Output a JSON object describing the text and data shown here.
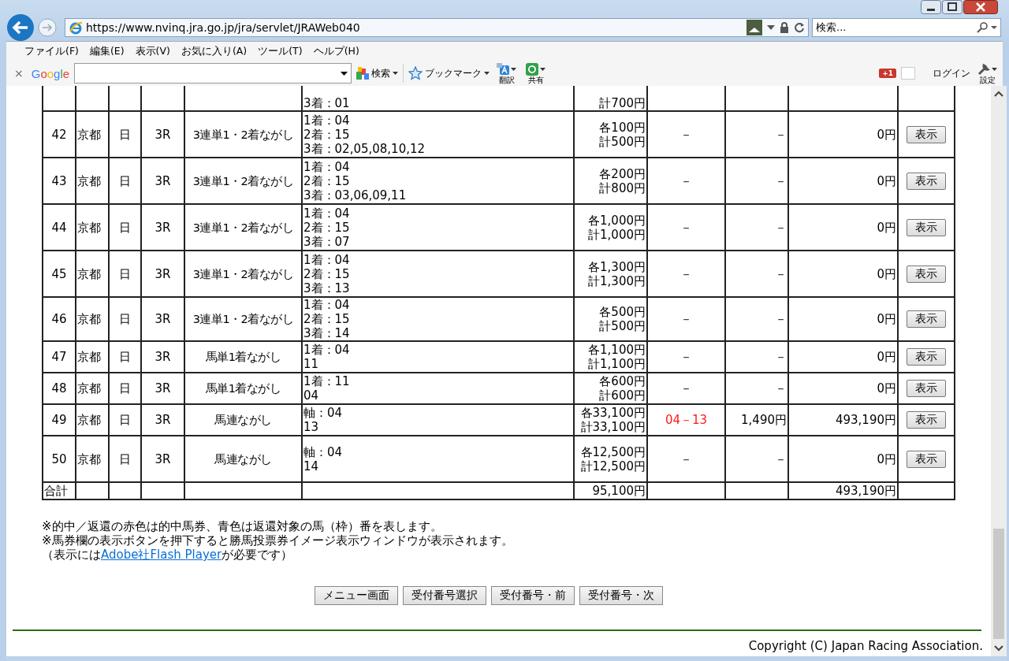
{
  "browser": {
    "url": "https://www.nvinq.jra.go.jp/jra/servlet/JRAWeb040",
    "search_placeholder": "検索...",
    "menu": [
      "ファイル(F)",
      "編集(E)",
      "表示(V)",
      "お気に入り(A)",
      "ツール(T)",
      "ヘルプ(H)"
    ],
    "toolbar": {
      "close": "×",
      "logo": "Google",
      "search": "検索",
      "bookmark": "ブックマーク",
      "translate": "翻訳",
      "share": "共有",
      "plus_one": "+1",
      "login": "ログイン",
      "settings": "設定"
    }
  },
  "table": {
    "cut_off_row": {
      "bets": [
        "3着：01"
      ],
      "amount": [
        "計700円"
      ]
    },
    "rows": [
      {
        "no": "42",
        "place": "京都",
        "day": "日",
        "race": "3R",
        "type": "3連単1・2着ながし",
        "bets": [
          "1着：04",
          "2着：15",
          "3着：02,05,08,10,12"
        ],
        "amount": [
          "各100円",
          "計500円"
        ],
        "hit": "－",
        "hit_win": false,
        "refund": "－",
        "payout": "0円",
        "button": "表示"
      },
      {
        "no": "43",
        "place": "京都",
        "day": "日",
        "race": "3R",
        "type": "3連単1・2着ながし",
        "bets": [
          "1着：04",
          "2着：15",
          "3着：03,06,09,11"
        ],
        "amount": [
          "各200円",
          "計800円"
        ],
        "hit": "－",
        "hit_win": false,
        "refund": "－",
        "payout": "0円",
        "button": "表示"
      },
      {
        "no": "44",
        "place": "京都",
        "day": "日",
        "race": "3R",
        "type": "3連単1・2着ながし",
        "bets": [
          "1着：04",
          "2着：15",
          "3着：07"
        ],
        "amount": [
          "各1,000円",
          "計1,000円"
        ],
        "hit": "－",
        "hit_win": false,
        "refund": "－",
        "payout": "0円",
        "button": "表示"
      },
      {
        "no": "45",
        "place": "京都",
        "day": "日",
        "race": "3R",
        "type": "3連単1・2着ながし",
        "bets": [
          "1着：04",
          "2着：15",
          "3着：13"
        ],
        "amount": [
          "各1,300円",
          "計1,300円"
        ],
        "hit": "－",
        "hit_win": false,
        "refund": "－",
        "payout": "0円",
        "button": "表示"
      },
      {
        "no": "46",
        "place": "京都",
        "day": "日",
        "race": "3R",
        "type": "3連単1・2着ながし",
        "bets": [
          "1着：04",
          "2着：15",
          "3着：14"
        ],
        "amount": [
          "各500円",
          "計500円"
        ],
        "hit": "－",
        "hit_win": false,
        "refund": "－",
        "payout": "0円",
        "button": "表示"
      },
      {
        "no": "47",
        "place": "京都",
        "day": "日",
        "race": "3R",
        "type": "馬単1着ながし",
        "bets": [
          "1着：04",
          "11"
        ],
        "amount": [
          "各1,100円",
          "計1,100円"
        ],
        "hit": "－",
        "hit_win": false,
        "refund": "－",
        "payout": "0円",
        "button": "表示"
      },
      {
        "no": "48",
        "place": "京都",
        "day": "日",
        "race": "3R",
        "type": "馬単1着ながし",
        "bets": [
          "1着：11",
          "04"
        ],
        "amount": [
          "各600円",
          "計600円"
        ],
        "hit": "－",
        "hit_win": false,
        "refund": "－",
        "payout": "0円",
        "button": "表示"
      },
      {
        "no": "49",
        "place": "京都",
        "day": "日",
        "race": "3R",
        "type": "馬連ながし",
        "bets": [
          "軸：04",
          "13"
        ],
        "amount": [
          "各33,100円",
          "計33,100円"
        ],
        "hit": "04－13",
        "hit_win": true,
        "refund": "1,490円",
        "payout": "493,190円",
        "button": "表示"
      },
      {
        "no": "50",
        "place": "京都",
        "day": "日",
        "race": "3R",
        "type": "馬連ながし",
        "bets": [
          "軸：04",
          "14"
        ],
        "amount": [
          "各12,500円",
          "計12,500円"
        ],
        "hit": "－",
        "hit_win": false,
        "refund": "－",
        "payout": "0円",
        "button": "表示"
      }
    ],
    "total": {
      "label": "合計",
      "amount": "95,100円",
      "payout": "493,190円"
    }
  },
  "notes": [
    {
      "text": "※的中／返還の赤色は的中馬券、青色は返還対象の馬（枠）番を表します。"
    },
    {
      "text": "※馬券欄の表示ボタンを押下すると勝馬投票券イメージ表示ウィンドウが表示されます。"
    },
    {
      "text": "（表示には",
      "link": "Adobe社Flash Player",
      "after": "が必要です）"
    }
  ],
  "buttons": [
    "メニュー画面",
    "受付番号選択",
    "受付番号・前",
    "受付番号・次"
  ],
  "copyright": "Copyright (C) Japan Racing Association."
}
